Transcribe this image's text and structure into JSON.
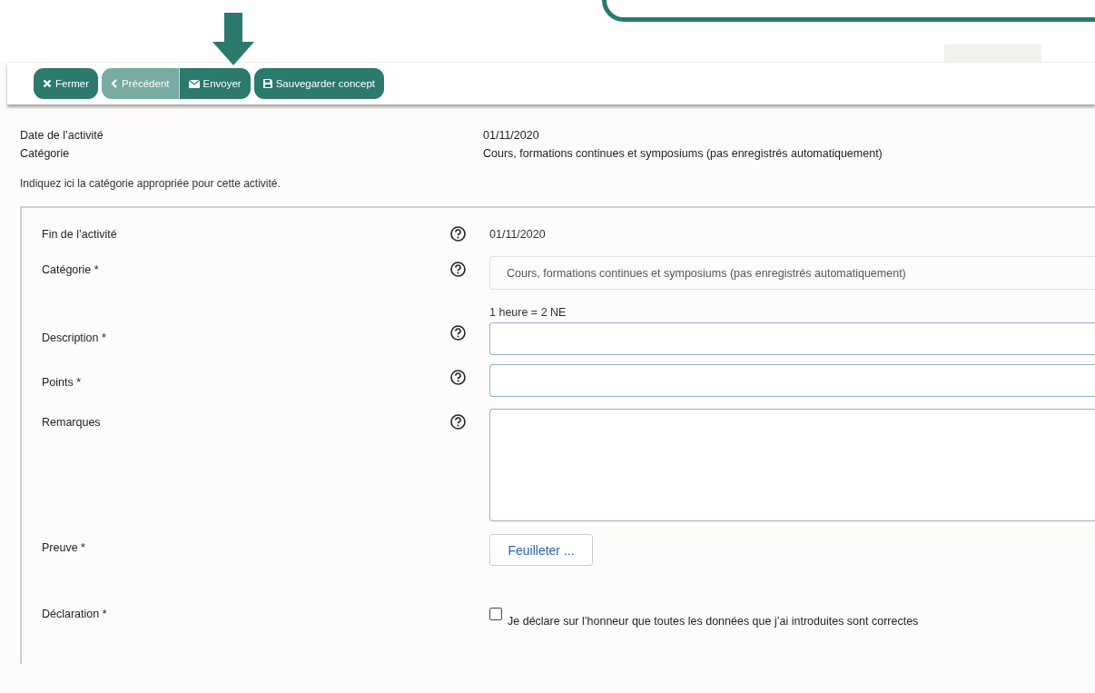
{
  "toolbar": {
    "buttons": [
      {
        "kind": "close",
        "label": "Fermer",
        "disabled": false
      },
      {
        "kind": "previous",
        "label": "Précédent",
        "disabled": true
      },
      {
        "kind": "send",
        "label": "Envoyer",
        "disabled": false
      },
      {
        "kind": "save",
        "label": "Sauvegarder concept",
        "disabled": false
      }
    ]
  },
  "summary": [
    {
      "label": "Date de l’activité",
      "value": "01/11/2020"
    },
    {
      "label": "Catégorie",
      "value": "Cours, formations continues et symposiums (pas enregistrés automatiquement)"
    }
  ],
  "instruction": "Indiquez ici la catégorie appropriée pour cette activité.",
  "fields": [
    {
      "kind": "text",
      "label": "Fin de l’activité",
      "help": true,
      "value": "01/11/2020"
    },
    {
      "kind": "select",
      "label": "Catégorie *",
      "help": true,
      "value": "Cours, formations continues et symposiums (pas enregistrés automatiquement)"
    },
    {
      "kind": "input",
      "label": "Description *",
      "help": true,
      "hint": "1 heure = 2 NE"
    },
    {
      "kind": "input",
      "label": "Points  *",
      "help": true
    },
    {
      "kind": "textarea",
      "label": "Remarques",
      "help": true
    },
    {
      "kind": "file",
      "label": "Preuve *",
      "help": false,
      "button": "Feuilleter ..."
    },
    {
      "kind": "checkbox",
      "label": "Déclaration *",
      "help": false,
      "checked": false,
      "text": "Je déclare sur l’honneur que toutes les données que j’ai introduites sont correctes"
    }
  ]
}
